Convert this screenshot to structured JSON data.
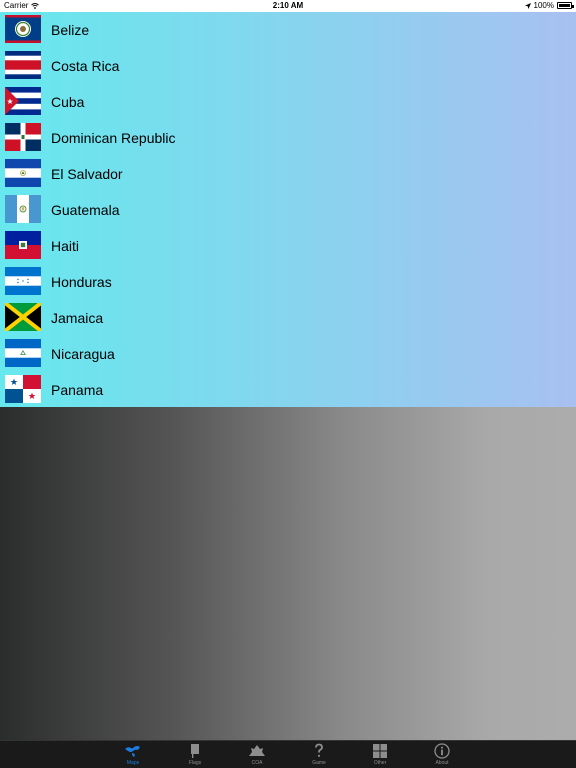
{
  "status_bar": {
    "carrier": "Carrier",
    "time": "2:10 AM",
    "battery": "100%"
  },
  "countries": [
    {
      "name": "Belize",
      "flag": "belize-flag"
    },
    {
      "name": "Costa Rica",
      "flag": "costa-rica-flag"
    },
    {
      "name": "Cuba",
      "flag": "cuba-flag"
    },
    {
      "name": "Dominican Republic",
      "flag": "dominican-republic-flag"
    },
    {
      "name": "El Salvador",
      "flag": "el-salvador-flag"
    },
    {
      "name": "Guatemala",
      "flag": "guatemala-flag"
    },
    {
      "name": "Haiti",
      "flag": "haiti-flag"
    },
    {
      "name": "Honduras",
      "flag": "honduras-flag"
    },
    {
      "name": "Jamaica",
      "flag": "jamaica-flag"
    },
    {
      "name": "Nicaragua",
      "flag": "nicaragua-flag"
    },
    {
      "name": "Panama",
      "flag": "panama-flag"
    }
  ],
  "tabs": [
    {
      "label": "Maps",
      "icon": "maps-icon",
      "active": true
    },
    {
      "label": "Flags",
      "icon": "flags-icon",
      "active": false
    },
    {
      "label": "COA",
      "icon": "coa-icon",
      "active": false
    },
    {
      "label": "Game",
      "icon": "question-icon",
      "active": false
    },
    {
      "label": "Other",
      "icon": "grid-icon",
      "active": false
    },
    {
      "label": "About",
      "icon": "info-icon",
      "active": false
    }
  ],
  "colors": {
    "tab_active": "#1a7fe0",
    "tab_inactive": "#8e8e8e",
    "tab_bar_bg": "#1a1a1a"
  }
}
